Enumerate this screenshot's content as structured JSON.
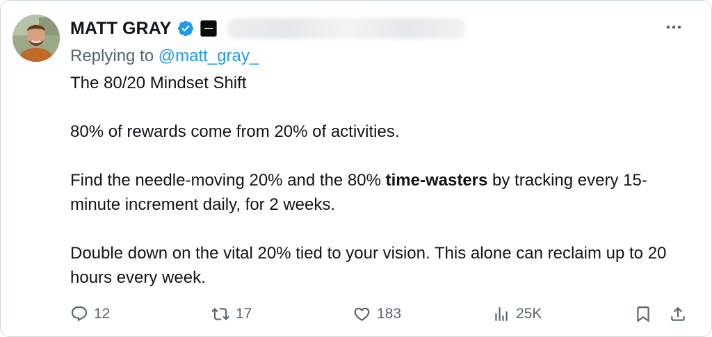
{
  "author": {
    "name": "MATT GRAY",
    "verified": true,
    "avatar": "avatar-photo",
    "affiliation_badge": "brand-badge-icon"
  },
  "reply": {
    "prefix": "Replying to ",
    "mention": "@matt_gray_"
  },
  "body": {
    "line1": "The 80/20 Mindset Shift",
    "line2": "80% of rewards come from 20% of activities.",
    "line3_before": "Find the needle-moving 20% and the 80% ",
    "line3_bold": "time-wasters",
    "line3_after": " by tracking every 15-minute increment daily, for 2 weeks.",
    "line4": "Double down on the vital 20% tied to your vision. This alone can reclaim up to 20 hours every week."
  },
  "actions": {
    "replies": "12",
    "reposts": "17",
    "likes": "183",
    "views": "25K"
  },
  "icons": {
    "more": "more-icon",
    "reply": "reply-icon",
    "repost": "repost-icon",
    "like": "heart-icon",
    "views": "views-icon",
    "bookmark": "bookmark-icon",
    "share": "share-icon",
    "verified": "verified-badge-icon"
  },
  "colors": {
    "text": "#0f1419",
    "secondary": "#536471",
    "accent": "#1d9bf0",
    "border": "#cfd9de"
  }
}
